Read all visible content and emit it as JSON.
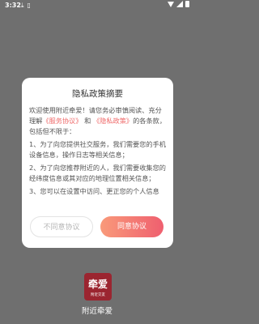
{
  "statusbar": {
    "time": "3:32",
    "icons": [
      "download-icon",
      "sim-icon"
    ]
  },
  "dialog": {
    "title": "隐私政策摘要",
    "intro_part1": "欢迎使用附近牵爱！请您务必审慎阅读、充分理解",
    "service_link": "《服务协议》",
    "and": "和",
    "privacy_link": "《隐私政策》",
    "intro_part2": "的各条款，包括但不限于：",
    "item1": "1、为了向您提供社交服务，我们需要您的手机设备信息，操作日志等相关信息；",
    "item2": "2、为了向您推荐附近的人，我们需要收集您的经纬度信息或其对应的地理位置相关信息；",
    "item3": "3、您可以在设置中访问、更正您的个人信息",
    "disagree_label": "不同意协议",
    "agree_label": "同意协议"
  },
  "brand": {
    "logo_text": "牵爱",
    "logo_subtext": "附近交友",
    "app_name": "附近牵爱",
    "logo_color": "#9b2530",
    "accent": "#ef5f6f"
  }
}
